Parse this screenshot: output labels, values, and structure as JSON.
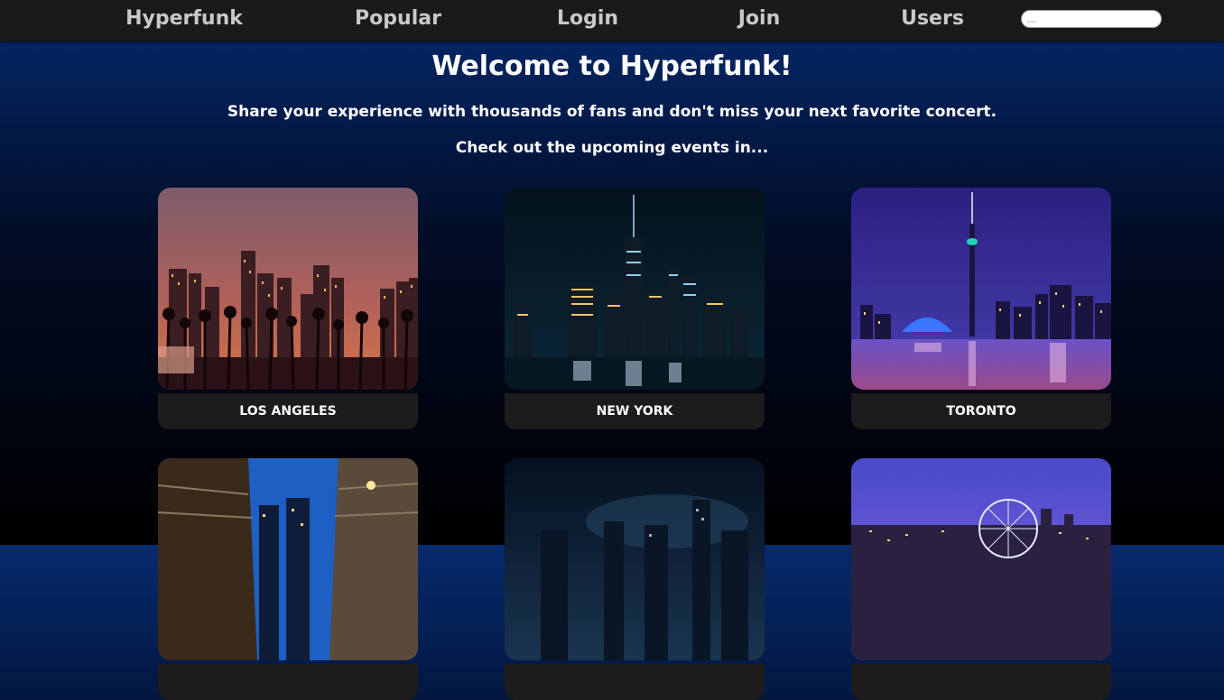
{
  "nav": {
    "brand": "Hyperfunk",
    "links": [
      "Popular",
      "Login",
      "Join",
      "Users"
    ],
    "search": {
      "placeholder": "...",
      "value": ""
    }
  },
  "hero": {
    "title": "Welcome to Hyperfunk!",
    "tagline": "Share your experience with thousands of fans and don't miss your next favorite concert.",
    "prompt": "Check out the upcoming events in..."
  },
  "cities": [
    {
      "name": "LOS ANGELES"
    },
    {
      "name": "NEW YORK"
    },
    {
      "name": "TORONTO"
    },
    {
      "name": ""
    },
    {
      "name": ""
    },
    {
      "name": ""
    }
  ]
}
